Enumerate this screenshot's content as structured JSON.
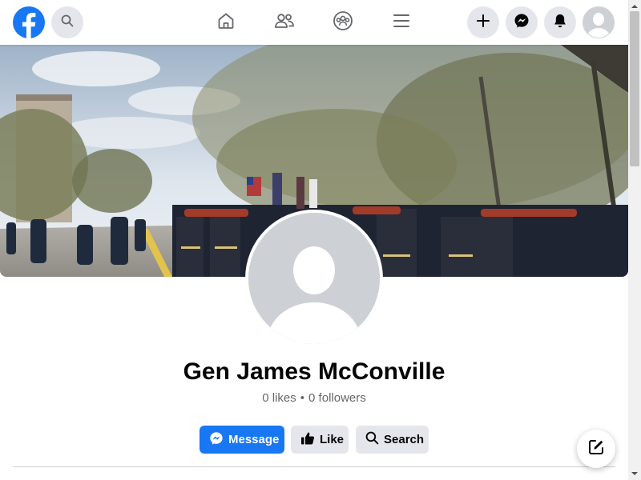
{
  "brand": {
    "logo_icon": "facebook-logo-icon",
    "color": "#1877f2"
  },
  "topbar": {
    "search_icon": "search-icon",
    "nav": [
      {
        "name": "home",
        "icon": "home-icon"
      },
      {
        "name": "friends",
        "icon": "friends-icon"
      },
      {
        "name": "groups",
        "icon": "groups-icon"
      },
      {
        "name": "menu",
        "icon": "menu-icon"
      }
    ],
    "actions": [
      {
        "name": "create",
        "icon": "plus-icon"
      },
      {
        "name": "messenger",
        "icon": "messenger-icon"
      },
      {
        "name": "notifications",
        "icon": "bell-icon"
      }
    ]
  },
  "profile": {
    "name": "Gen James McConville",
    "likes": "0 likes",
    "separator": "•",
    "followers": "0 followers"
  },
  "buttons": {
    "message": "Message",
    "like": "Like",
    "search": "Search"
  },
  "colors": {
    "primary": "#1877f2",
    "secondary_button": "#e4e6eb",
    "muted_text": "#65676b"
  }
}
